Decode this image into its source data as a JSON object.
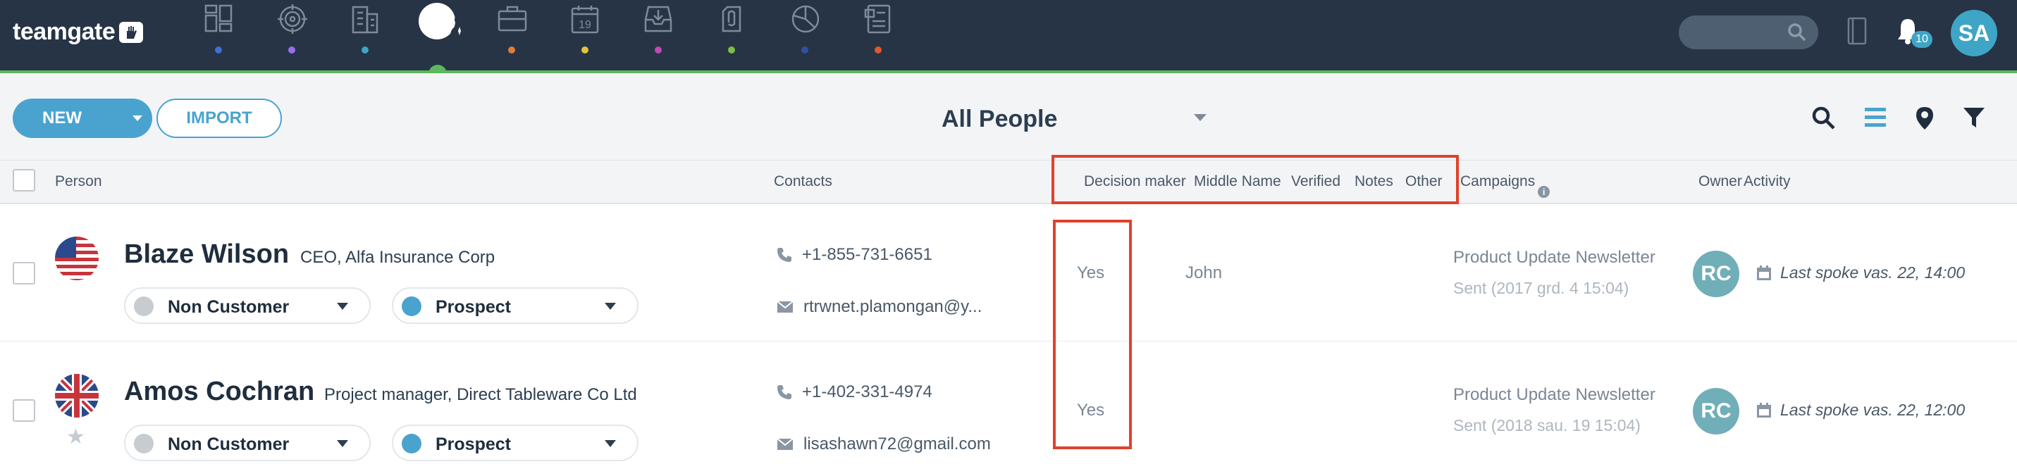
{
  "app": {
    "logo_text": "teamgate"
  },
  "nav": {
    "items": [
      {
        "icon": "dashboard-icon",
        "dot_color": "#3d6fd6"
      },
      {
        "icon": "target-icon",
        "dot_color": "#9b6cf0"
      },
      {
        "icon": "companies-icon",
        "dot_color": "#3ea5c6"
      },
      {
        "icon": "people-icon",
        "dot_color": "#5cb85c",
        "active": true
      },
      {
        "icon": "briefcase-icon",
        "dot_color": "#e07b39"
      },
      {
        "icon": "calendar-icon",
        "dot_color": "#e0c43a",
        "label": "19"
      },
      {
        "icon": "inbox-download-icon",
        "dot_color": "#c24ab0"
      },
      {
        "icon": "attachment-icon",
        "dot_color": "#7bc043"
      },
      {
        "icon": "pie-chart-icon",
        "dot_color": "#2f4fa0"
      },
      {
        "icon": "document-icon",
        "dot_color": "#e0582b"
      }
    ],
    "notifications_count": "10",
    "user_initials": "SA"
  },
  "toolbar": {
    "new_label": "NEW",
    "import_label": "IMPORT",
    "view_title": "All People"
  },
  "table": {
    "headers": {
      "person": "Person",
      "contacts": "Contacts",
      "decision_maker": "Decision maker",
      "middle_name": "Middle Name",
      "verified": "Verified",
      "notes": "Notes",
      "other": "Other",
      "campaigns": "Campaigns",
      "owner": "Owner",
      "activity": "Activity"
    },
    "rows": [
      {
        "name": "Blaze Wilson",
        "title": "CEO, Alfa Insurance Corp",
        "flag": "us",
        "status_1": {
          "label": "Non Customer",
          "color": "#c8ccd1"
        },
        "status_2": {
          "label": "Prospect",
          "color": "#4aa3cf"
        },
        "phone": "+1-855-731-6651",
        "email": "rtrwnet.plamongan@y...",
        "decision_maker": "Yes",
        "middle_name": "John",
        "campaign": "Product Update Newsletter",
        "campaign_sent": "Sent (2017 grd. 4 15:04)",
        "owner_initials": "RC",
        "activity": "Last spoke vas. 22, 14:00"
      },
      {
        "name": "Amos Cochran",
        "title": "Project manager, Direct Tableware Co Ltd",
        "flag": "uk",
        "status_1": {
          "label": "Non Customer",
          "color": "#c8ccd1"
        },
        "status_2": {
          "label": "Prospect",
          "color": "#4aa3cf"
        },
        "phone": "+1-402-331-4974",
        "email": "lisashawn72@gmail.com",
        "decision_maker": "Yes",
        "middle_name": "",
        "campaign": "Product Update Newsletter",
        "campaign_sent": "Sent (2018 sau. 19 15:04)",
        "owner_initials": "RC",
        "activity": "Last spoke vas. 22, 12:00"
      }
    ]
  },
  "colors": {
    "navbar": "#263445",
    "accent": "#4aa3cf",
    "highlight": "#e0412b",
    "active_green": "#5cb85c"
  }
}
